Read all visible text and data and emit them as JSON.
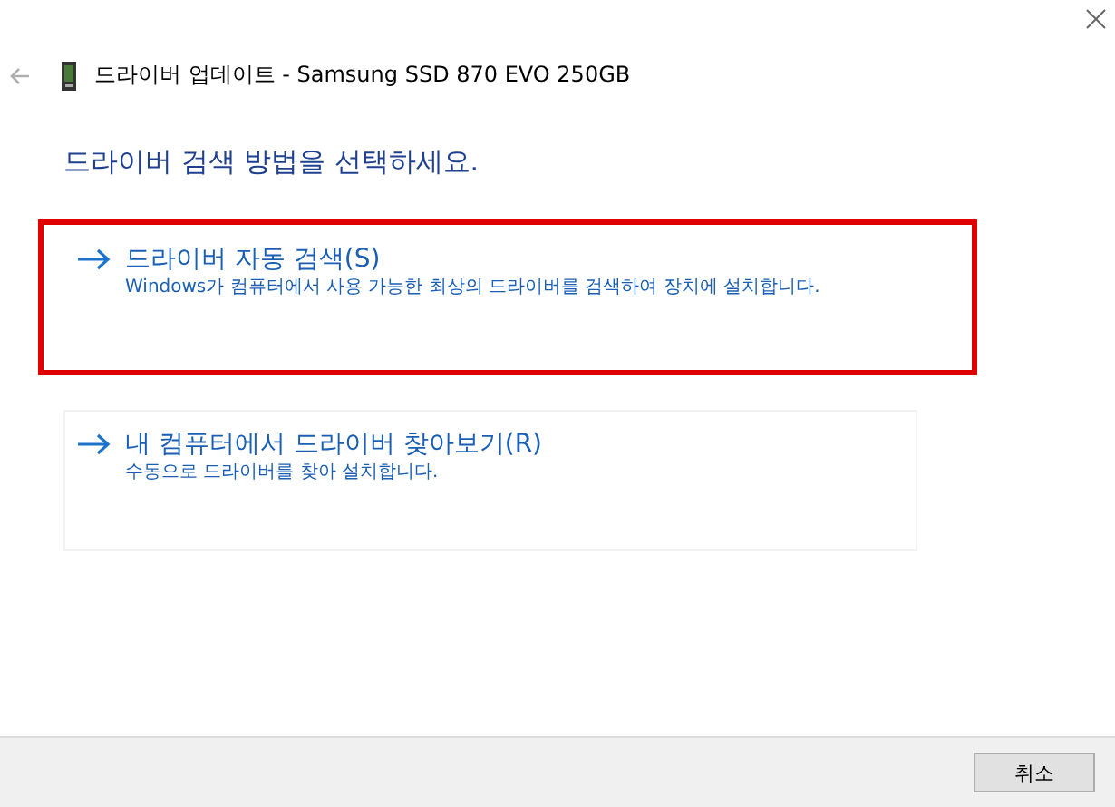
{
  "window": {
    "title": "드라이버 업데이트 - Samsung SSD 870 EVO 250GB"
  },
  "heading": "드라이버 검색 방법을 선택하세요.",
  "options": [
    {
      "title": "드라이버 자동 검색(S)",
      "description": "Windows가 컴퓨터에서 사용 가능한 최상의 드라이버를 검색하여 장치에 설치합니다.",
      "highlighted": true
    },
    {
      "title": "내 컴퓨터에서 드라이버 찾아보기(R)",
      "description": "수동으로 드라이버를 찾아 설치합니다.",
      "highlighted": false
    }
  ],
  "buttons": [
    "취소"
  ]
}
